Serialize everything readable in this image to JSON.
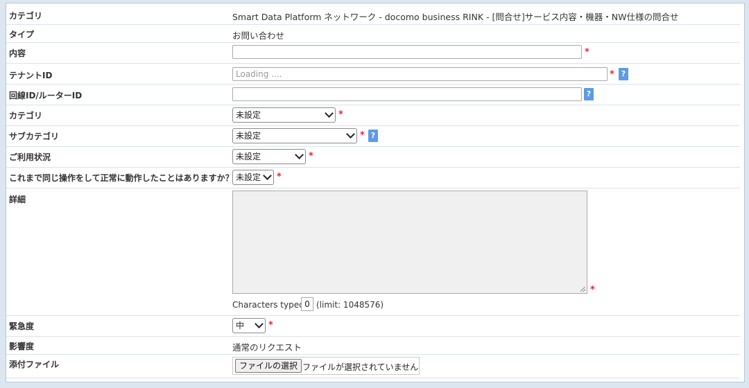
{
  "form": {
    "category_label": "カテゴリ",
    "category_value": "Smart Data Platform ネットワーク - docomo business RINK - [問合せ]サービス内容・機器・NW仕様の問合せ",
    "type_label": "タイプ",
    "type_value": "お問い合わせ",
    "content_label": "内容",
    "content_value": "",
    "tenant_label": "テナントID",
    "tenant_placeholder": "Loading ....",
    "line_label": "回線ID/ルーターID",
    "line_value": "",
    "category2_label": "カテゴリ",
    "category2_value": "未設定",
    "subcategory_label": "サブカテゴリ",
    "subcategory_value": "未設定",
    "usage_label": "ご利用状況",
    "usage_value": "未設定",
    "worked_before_label": "これまで同じ操作をして正常に動作したことはありますか？",
    "worked_before_value": "未設定",
    "detail_label": "詳細",
    "detail_value": "",
    "chars_typed_label": "Characters typed:",
    "chars_typed_value": "0",
    "chars_limit": "(limit: 1048576)",
    "urgency_label": "緊急度",
    "urgency_value": "中",
    "impact_label": "影響度",
    "impact_value": "通常のリクエスト",
    "attachment_label": "添付ファイル",
    "file_button": "ファイルの選択",
    "file_status": "ファイルが選択されていません",
    "required_mark": "*",
    "help_mark": "?"
  }
}
